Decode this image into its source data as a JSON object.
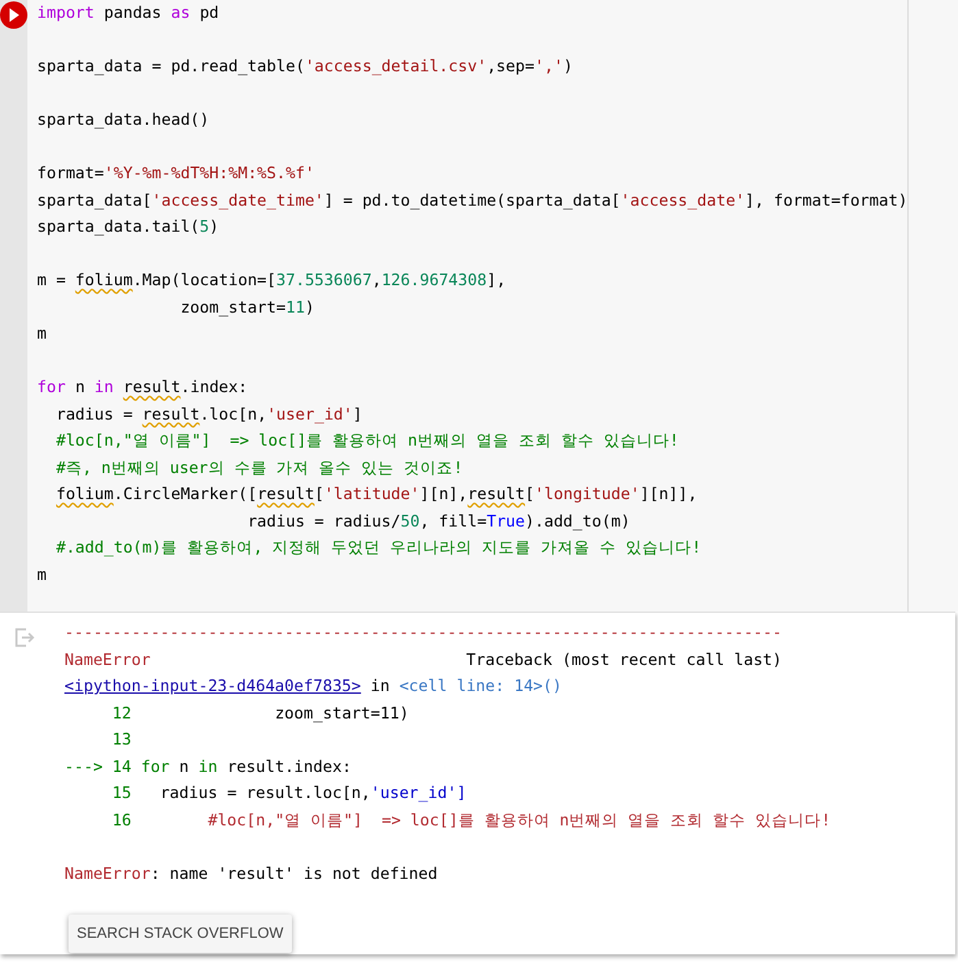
{
  "code_cell": {
    "lines": [
      {
        "kind": "code",
        "tokens": [
          {
            "t": "import",
            "kind": "keyword"
          },
          {
            "t": " pandas ",
            "kind": "plain"
          },
          {
            "t": "as",
            "kind": "keyword"
          },
          {
            "t": " pd",
            "kind": "plain"
          }
        ]
      },
      {
        "kind": "blank"
      },
      {
        "kind": "code",
        "tokens": [
          {
            "t": "sparta_data = pd.read_table(",
            "kind": "plain"
          },
          {
            "t": "'access_detail.csv'",
            "kind": "string"
          },
          {
            "t": ",sep=",
            "kind": "plain"
          },
          {
            "t": "','",
            "kind": "string"
          },
          {
            "t": ")",
            "kind": "plain"
          }
        ]
      },
      {
        "kind": "blank"
      },
      {
        "kind": "code",
        "tokens": [
          {
            "t": "sparta_data.head()",
            "kind": "plain"
          }
        ]
      },
      {
        "kind": "blank"
      },
      {
        "kind": "code",
        "tokens": [
          {
            "t": "format=",
            "kind": "plain"
          },
          {
            "t": "'%Y-%m-%dT%H:%M:%S.%f'",
            "kind": "string"
          }
        ]
      },
      {
        "kind": "code",
        "tokens": [
          {
            "t": "sparta_data[",
            "kind": "plain"
          },
          {
            "t": "'access_date_time'",
            "kind": "string"
          },
          {
            "t": "] = pd.to_datetime(sparta_data[",
            "kind": "plain"
          },
          {
            "t": "'access_date'",
            "kind": "string"
          },
          {
            "t": "], format=format)",
            "kind": "plain"
          }
        ]
      },
      {
        "kind": "code",
        "tokens": [
          {
            "t": "sparta_data.tail(",
            "kind": "plain"
          },
          {
            "t": "5",
            "kind": "number"
          },
          {
            "t": ")",
            "kind": "plain"
          }
        ]
      },
      {
        "kind": "blank"
      },
      {
        "kind": "code",
        "tokens": [
          {
            "t": "m = ",
            "kind": "plain"
          },
          {
            "t": "folium",
            "kind": "warn"
          },
          {
            "t": ".Map(location=[",
            "kind": "plain"
          },
          {
            "t": "37.5536067",
            "kind": "number"
          },
          {
            "t": ",",
            "kind": "plain"
          },
          {
            "t": "126.9674308",
            "kind": "number"
          },
          {
            "t": "],",
            "kind": "plain"
          }
        ]
      },
      {
        "kind": "code",
        "tokens": [
          {
            "t": "               zoom_start=",
            "kind": "plain"
          },
          {
            "t": "11",
            "kind": "number"
          },
          {
            "t": ")",
            "kind": "plain"
          }
        ]
      },
      {
        "kind": "code",
        "tokens": [
          {
            "t": "m",
            "kind": "plain"
          }
        ]
      },
      {
        "kind": "blank"
      },
      {
        "kind": "code",
        "tokens": [
          {
            "t": "for",
            "kind": "keyword"
          },
          {
            "t": " n ",
            "kind": "plain"
          },
          {
            "t": "in",
            "kind": "keyword"
          },
          {
            "t": " result",
            "kind": "warn"
          },
          {
            "t": ".index:",
            "kind": "plain"
          }
        ]
      },
      {
        "kind": "code",
        "tokens": [
          {
            "t": "  radius = ",
            "kind": "plain"
          },
          {
            "t": "result",
            "kind": "warn"
          },
          {
            "t": ".loc[n,",
            "kind": "plain"
          },
          {
            "t": "'user_id'",
            "kind": "string"
          },
          {
            "t": "]",
            "kind": "plain"
          }
        ]
      },
      {
        "kind": "code",
        "tokens": [
          {
            "t": "  #loc[n,\"열 이름\"]  => loc[]를 활용하여 n번째의 열을 조회 할수 있습니다!",
            "kind": "comment"
          }
        ]
      },
      {
        "kind": "code",
        "tokens": [
          {
            "t": "  #즉, n번째의 user의 수를 가져 올수 있는 것이죠!",
            "kind": "comment"
          }
        ]
      },
      {
        "kind": "code",
        "tokens": [
          {
            "t": "  folium",
            "kind": "warn"
          },
          {
            "t": ".CircleMarker([",
            "kind": "plain"
          },
          {
            "t": "result",
            "kind": "warn"
          },
          {
            "t": "[",
            "kind": "plain"
          },
          {
            "t": "'latitude'",
            "kind": "string"
          },
          {
            "t": "][n],",
            "kind": "plain"
          },
          {
            "t": "result",
            "kind": "warn"
          },
          {
            "t": "[",
            "kind": "plain"
          },
          {
            "t": "'longitude'",
            "kind": "string"
          },
          {
            "t": "][n]],",
            "kind": "plain"
          }
        ]
      },
      {
        "kind": "code",
        "tokens": [
          {
            "t": "                      radius = radius/",
            "kind": "plain"
          },
          {
            "t": "50",
            "kind": "number"
          },
          {
            "t": ", fill=",
            "kind": "plain"
          },
          {
            "t": "True",
            "kind": "constant"
          },
          {
            "t": ").add_to(m)",
            "kind": "plain"
          }
        ]
      },
      {
        "kind": "code",
        "tokens": [
          {
            "t": "  #.add_to(m)를 활용하여, 지정해 두었던 우리나라의 지도를 가져올 수 있습니다!",
            "kind": "comment"
          }
        ]
      },
      {
        "kind": "code",
        "tokens": [
          {
            "t": "m",
            "kind": "plain"
          }
        ]
      }
    ]
  },
  "output": {
    "lines": [
      {
        "kind": "code",
        "tokens": [
          {
            "t": "---------------------------------------------------------------------------",
            "kind": "error"
          }
        ]
      },
      {
        "kind": "code",
        "tokens": [
          {
            "t": "NameError",
            "kind": "error"
          },
          {
            "t": "                                 Traceback (most recent call last)",
            "kind": "plain"
          }
        ]
      },
      {
        "kind": "code",
        "tokens": [
          {
            "t": "<ipython-input-23-d464a0ef7835>",
            "kind": "link"
          },
          {
            "t": " in ",
            "kind": "plain"
          },
          {
            "t": "<cell line: 14>()",
            "kind": "cellref"
          }
        ]
      },
      {
        "kind": "code",
        "tokens": [
          {
            "t": "     12",
            "kind": "lineno"
          },
          {
            "t": "               zoom_start=11)",
            "kind": "plain"
          }
        ]
      },
      {
        "kind": "code",
        "tokens": [
          {
            "t": "     13",
            "kind": "lineno"
          }
        ]
      },
      {
        "kind": "code",
        "tokens": [
          {
            "t": "---> 14 for",
            "kind": "lineno"
          },
          {
            "t": " n ",
            "kind": "plain"
          },
          {
            "t": "in",
            "kind": "lineno"
          },
          {
            "t": " result.index:",
            "kind": "plain"
          }
        ]
      },
      {
        "kind": "code",
        "tokens": [
          {
            "t": "     15",
            "kind": "lineno"
          },
          {
            "t": "   radius = result.loc[n,",
            "kind": "plain"
          },
          {
            "t": "'user_id'",
            "kind": "cellstring"
          },
          {
            "t": "]",
            "kind": "cellstring"
          }
        ]
      },
      {
        "kind": "code",
        "tokens": [
          {
            "t": "     16",
            "kind": "lineno"
          },
          {
            "t": "        #loc[n,\"열 이름\"]  => loc[]를 활용하여 n번째의 열을 조회 할수 있습니다!",
            "kind": "error"
          }
        ]
      },
      {
        "kind": "blank"
      },
      {
        "kind": "code",
        "tokens": [
          {
            "t": "NameError",
            "kind": "error"
          },
          {
            "t": ": name 'result' is not defined",
            "kind": "plain"
          }
        ]
      }
    ],
    "button": "SEARCH STACK OVERFLOW"
  }
}
